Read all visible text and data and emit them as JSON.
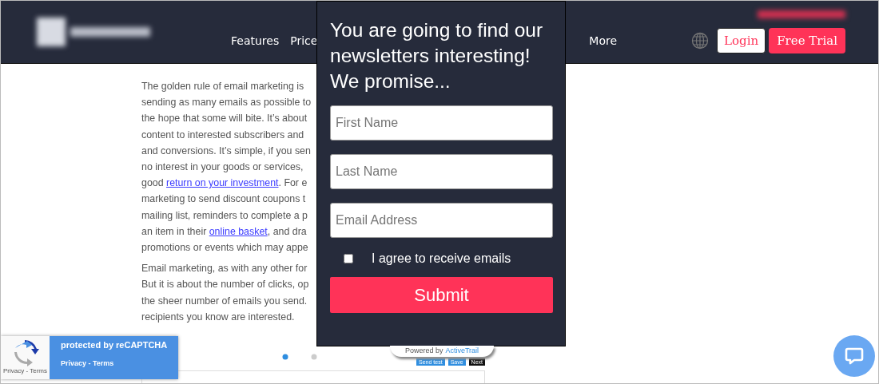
{
  "header": {
    "nav": [
      "Features",
      "Price",
      "More"
    ],
    "login": "Login",
    "free_trial": "Free Trial"
  },
  "article": {
    "paragraphs": [
      [
        [
          {
            "text": "The golden rule of email marketing is"
          }
        ],
        [
          {
            "text": "sending as many emails as possible to"
          }
        ],
        [
          {
            "text": "the hope that some will bite. It’s about"
          }
        ],
        [
          {
            "text": "content to interested subscribers and"
          }
        ],
        [
          {
            "text": "and conversions. It’s simple, if you sen"
          }
        ],
        [
          {
            "text": "no interest in your goods or services,"
          }
        ],
        [
          {
            "text": "good "
          },
          {
            "text": "return on your investment",
            "link": true
          },
          {
            "text": ". For e"
          }
        ],
        [
          {
            "text": "marketing to send discount coupons t"
          }
        ],
        [
          {
            "text": "mailing list, reminders to complete a p"
          }
        ],
        [
          {
            "text": "an item in their "
          },
          {
            "text": "online basket",
            "link": true
          },
          {
            "text": ", and dra"
          }
        ],
        [
          {
            "text": "promotions or events which may appe"
          }
        ]
      ],
      [
        [
          {
            "text": "Email marketing, as with any other for"
          }
        ],
        [
          {
            "text": "But it is about the number of clicks, op"
          }
        ],
        [
          {
            "text": "the sheer number of emails you send."
          }
        ],
        [
          {
            "text": "recipients you know are interested."
          }
        ]
      ]
    ]
  },
  "embed": {
    "buttons": [
      {
        "label": "Send test",
        "kind": "blue"
      },
      {
        "label": "Save",
        "kind": "blue"
      },
      {
        "label": "Next",
        "kind": "dark"
      }
    ]
  },
  "popup": {
    "title": "You are going to find our newsletters interesting! We promise...",
    "fields": [
      {
        "placeholder": "First Name"
      },
      {
        "placeholder": "Last Name"
      },
      {
        "placeholder": "Email Address"
      }
    ],
    "consent": {
      "label": "I agree to receive emails",
      "checked": false
    },
    "submit": "Submit",
    "powered_by": "Powered by",
    "brand": "ActiveTrail"
  },
  "recaptcha": {
    "title": "protected by reCAPTCHA",
    "links": "Privacy - Terms",
    "small_links": "Privacy - Terms"
  }
}
